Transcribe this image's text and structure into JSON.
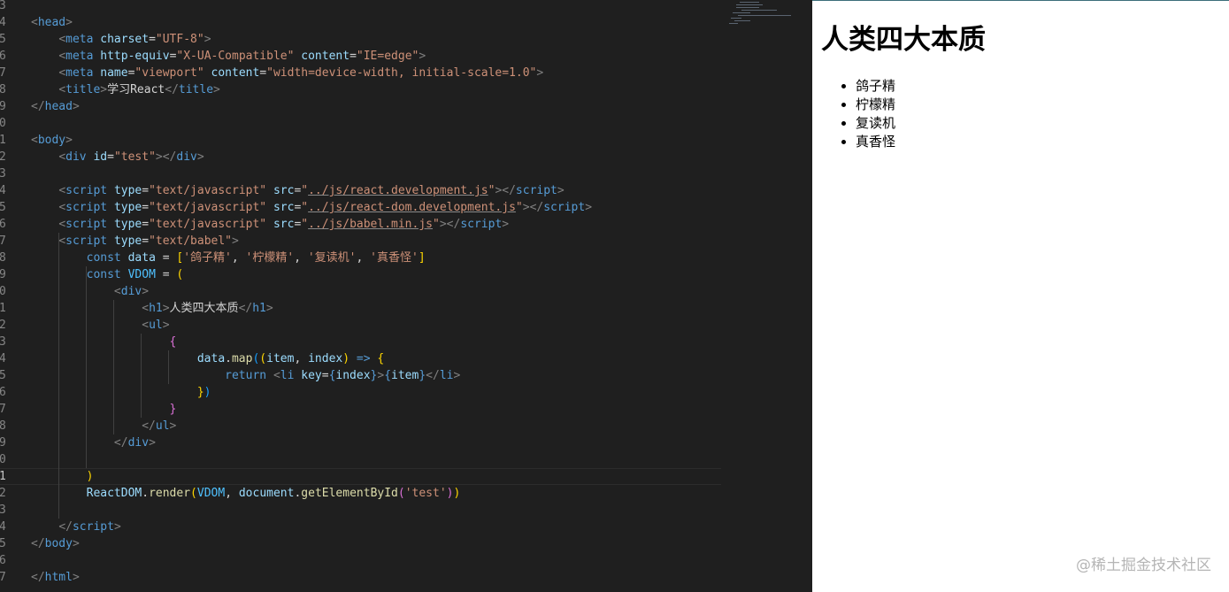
{
  "editor": {
    "lines": [
      {
        "num": "3",
        "tokens": []
      },
      {
        "num": "4",
        "tokens": [
          [
            "br",
            "<"
          ],
          [
            "tg",
            "head"
          ],
          [
            "br",
            ">"
          ]
        ]
      },
      {
        "num": "5",
        "tokens": [
          [
            "tx",
            "    "
          ],
          [
            "br",
            "<"
          ],
          [
            "tg",
            "meta "
          ],
          [
            "at",
            "charset"
          ],
          [
            "tx",
            "="
          ],
          [
            "st",
            "\"UTF-8\""
          ],
          [
            "br",
            ">"
          ]
        ]
      },
      {
        "num": "6",
        "tokens": [
          [
            "tx",
            "    "
          ],
          [
            "br",
            "<"
          ],
          [
            "tg",
            "meta "
          ],
          [
            "at",
            "http-equiv"
          ],
          [
            "tx",
            "="
          ],
          [
            "st",
            "\"X-UA-Compatible\" "
          ],
          [
            "at",
            "content"
          ],
          [
            "tx",
            "="
          ],
          [
            "st",
            "\"IE=edge\""
          ],
          [
            "br",
            ">"
          ]
        ]
      },
      {
        "num": "7",
        "tokens": [
          [
            "tx",
            "    "
          ],
          [
            "br",
            "<"
          ],
          [
            "tg",
            "meta "
          ],
          [
            "at",
            "name"
          ],
          [
            "tx",
            "="
          ],
          [
            "st",
            "\"viewport\" "
          ],
          [
            "at",
            "content"
          ],
          [
            "tx",
            "="
          ],
          [
            "st",
            "\"width=device-width, initial-scale=1.0\""
          ],
          [
            "br",
            ">"
          ]
        ]
      },
      {
        "num": "8",
        "tokens": [
          [
            "tx",
            "    "
          ],
          [
            "br",
            "<"
          ],
          [
            "tg",
            "title"
          ],
          [
            "br",
            ">"
          ],
          [
            "tx",
            "学习React"
          ],
          [
            "br",
            "</"
          ],
          [
            "tg",
            "title"
          ],
          [
            "br",
            ">"
          ]
        ]
      },
      {
        "num": "9",
        "tokens": [
          [
            "br",
            "</"
          ],
          [
            "tg",
            "head"
          ],
          [
            "br",
            ">"
          ]
        ]
      },
      {
        "num": "0",
        "tokens": []
      },
      {
        "num": "1",
        "tokens": [
          [
            "br",
            "<"
          ],
          [
            "tg",
            "body"
          ],
          [
            "br",
            ">"
          ]
        ]
      },
      {
        "num": "2",
        "tokens": [
          [
            "tx",
            "    "
          ],
          [
            "br",
            "<"
          ],
          [
            "tg",
            "div "
          ],
          [
            "at",
            "id"
          ],
          [
            "tx",
            "="
          ],
          [
            "st",
            "\"test\""
          ],
          [
            "br",
            "></"
          ],
          [
            "tg",
            "div"
          ],
          [
            "br",
            ">"
          ]
        ]
      },
      {
        "num": "3",
        "tokens": []
      },
      {
        "num": "4",
        "tokens": [
          [
            "tx",
            "    "
          ],
          [
            "br",
            "<"
          ],
          [
            "tg",
            "script "
          ],
          [
            "at",
            "type"
          ],
          [
            "tx",
            "="
          ],
          [
            "st",
            "\"text/javascript\" "
          ],
          [
            "at",
            "src"
          ],
          [
            "tx",
            "="
          ],
          [
            "st",
            "\""
          ],
          [
            "lk",
            "../js/react.development.js"
          ],
          [
            "st",
            "\""
          ],
          [
            "br",
            "></"
          ],
          [
            "tg",
            "script"
          ],
          [
            "br",
            ">"
          ]
        ]
      },
      {
        "num": "5",
        "tokens": [
          [
            "tx",
            "    "
          ],
          [
            "br",
            "<"
          ],
          [
            "tg",
            "script "
          ],
          [
            "at",
            "type"
          ],
          [
            "tx",
            "="
          ],
          [
            "st",
            "\"text/javascript\" "
          ],
          [
            "at",
            "src"
          ],
          [
            "tx",
            "="
          ],
          [
            "st",
            "\""
          ],
          [
            "lk",
            "../js/react-dom.development.js"
          ],
          [
            "st",
            "\""
          ],
          [
            "br",
            "></"
          ],
          [
            "tg",
            "script"
          ],
          [
            "br",
            ">"
          ]
        ]
      },
      {
        "num": "6",
        "tokens": [
          [
            "tx",
            "    "
          ],
          [
            "br",
            "<"
          ],
          [
            "tg",
            "script "
          ],
          [
            "at",
            "type"
          ],
          [
            "tx",
            "="
          ],
          [
            "st",
            "\"text/javascript\" "
          ],
          [
            "at",
            "src"
          ],
          [
            "tx",
            "="
          ],
          [
            "st",
            "\""
          ],
          [
            "lk",
            "../js/babel.min.js"
          ],
          [
            "st",
            "\""
          ],
          [
            "br",
            "></"
          ],
          [
            "tg",
            "script"
          ],
          [
            "br",
            ">"
          ]
        ]
      },
      {
        "num": "7",
        "tokens": [
          [
            "tx",
            "    "
          ],
          [
            "br",
            "<"
          ],
          [
            "tg",
            "script "
          ],
          [
            "at",
            "type"
          ],
          [
            "tx",
            "="
          ],
          [
            "st",
            "\"text/babel\""
          ],
          [
            "br",
            ">"
          ]
        ]
      },
      {
        "num": "8",
        "tokens": [
          [
            "tx",
            "        "
          ],
          [
            "kw",
            "const "
          ],
          [
            "vr",
            "data"
          ],
          [
            "tx",
            " = "
          ],
          [
            "b1",
            "["
          ],
          [
            "st",
            "'鸽子精'"
          ],
          [
            "tx",
            ", "
          ],
          [
            "st",
            "'柠檬精'"
          ],
          [
            "tx",
            ", "
          ],
          [
            "st",
            "'复读机'"
          ],
          [
            "tx",
            ", "
          ],
          [
            "st",
            "'真香怪'"
          ],
          [
            "b1",
            "]"
          ]
        ]
      },
      {
        "num": "9",
        "tokens": [
          [
            "tx",
            "        "
          ],
          [
            "kw",
            "const "
          ],
          [
            "cn",
            "VDOM"
          ],
          [
            "tx",
            " = "
          ],
          [
            "b1",
            "("
          ]
        ]
      },
      {
        "num": "0",
        "tokens": [
          [
            "tx",
            "            "
          ],
          [
            "br",
            "<"
          ],
          [
            "tg",
            "div"
          ],
          [
            "br",
            ">"
          ]
        ]
      },
      {
        "num": "1",
        "tokens": [
          [
            "tx",
            "                "
          ],
          [
            "br",
            "<"
          ],
          [
            "tg",
            "h1"
          ],
          [
            "br",
            ">"
          ],
          [
            "tx",
            "人类四大本质"
          ],
          [
            "br",
            "</"
          ],
          [
            "tg",
            "h1"
          ],
          [
            "br",
            ">"
          ]
        ]
      },
      {
        "num": "2",
        "tokens": [
          [
            "tx",
            "                "
          ],
          [
            "br",
            "<"
          ],
          [
            "tg",
            "ul"
          ],
          [
            "br",
            ">"
          ]
        ]
      },
      {
        "num": "3",
        "tokens": [
          [
            "tx",
            "                    "
          ],
          [
            "b2",
            "{"
          ]
        ]
      },
      {
        "num": "4",
        "tokens": [
          [
            "tx",
            "                        "
          ],
          [
            "vr",
            "data"
          ],
          [
            "tx",
            "."
          ],
          [
            "fn",
            "map"
          ],
          [
            "b3",
            "("
          ],
          [
            "b1",
            "("
          ],
          [
            "vr",
            "item"
          ],
          [
            "tx",
            ", "
          ],
          [
            "vr",
            "index"
          ],
          [
            "b1",
            ")"
          ],
          [
            "tx",
            " "
          ],
          [
            "kw",
            "=>"
          ],
          [
            "tx",
            " "
          ],
          [
            "b1",
            "{"
          ]
        ]
      },
      {
        "num": "5",
        "tokens": [
          [
            "tx",
            "                            "
          ],
          [
            "kw",
            "return "
          ],
          [
            "br",
            "<"
          ],
          [
            "tg",
            "li "
          ],
          [
            "at",
            "key"
          ],
          [
            "tx",
            "="
          ],
          [
            "kw",
            "{"
          ],
          [
            "vr",
            "index"
          ],
          [
            "kw",
            "}"
          ],
          [
            "br",
            ">"
          ],
          [
            "kw",
            "{"
          ],
          [
            "vr",
            "item"
          ],
          [
            "kw",
            "}"
          ],
          [
            "br",
            "</"
          ],
          [
            "tg",
            "li"
          ],
          [
            "br",
            ">"
          ]
        ]
      },
      {
        "num": "6",
        "tokens": [
          [
            "tx",
            "                        "
          ],
          [
            "b1",
            "}"
          ],
          [
            "b3",
            ")"
          ]
        ]
      },
      {
        "num": "7",
        "tokens": [
          [
            "tx",
            "                    "
          ],
          [
            "b2",
            "}"
          ]
        ]
      },
      {
        "num": "8",
        "tokens": [
          [
            "tx",
            "                "
          ],
          [
            "br",
            "</"
          ],
          [
            "tg",
            "ul"
          ],
          [
            "br",
            ">"
          ]
        ]
      },
      {
        "num": "9",
        "tokens": [
          [
            "tx",
            "            "
          ],
          [
            "br",
            "</"
          ],
          [
            "tg",
            "div"
          ],
          [
            "br",
            ">"
          ]
        ]
      },
      {
        "num": "0",
        "tokens": []
      },
      {
        "num": "1",
        "tokens": [
          [
            "tx",
            "        "
          ],
          [
            "b1",
            ")"
          ]
        ]
      },
      {
        "num": "2",
        "tokens": [
          [
            "tx",
            "        "
          ],
          [
            "vr",
            "ReactDOM"
          ],
          [
            "tx",
            "."
          ],
          [
            "fn",
            "render"
          ],
          [
            "b1",
            "("
          ],
          [
            "cn",
            "VDOM"
          ],
          [
            "tx",
            ", "
          ],
          [
            "vr",
            "document"
          ],
          [
            "tx",
            "."
          ],
          [
            "fn",
            "getElementById"
          ],
          [
            "b2",
            "("
          ],
          [
            "st",
            "'test'"
          ],
          [
            "b2",
            ")"
          ],
          [
            "b1",
            ")"
          ]
        ]
      },
      {
        "num": "3",
        "tokens": []
      },
      {
        "num": "4",
        "tokens": [
          [
            "tx",
            "    "
          ],
          [
            "br",
            "</"
          ],
          [
            "tg",
            "script"
          ],
          [
            "br",
            ">"
          ]
        ]
      },
      {
        "num": "5",
        "tokens": [
          [
            "br",
            "</"
          ],
          [
            "tg",
            "body"
          ],
          [
            "br",
            ">"
          ]
        ]
      },
      {
        "num": "6",
        "tokens": []
      },
      {
        "num": "7",
        "tokens": [
          [
            "br",
            "</"
          ],
          [
            "tg",
            "html"
          ],
          [
            "br",
            ">"
          ]
        ]
      }
    ],
    "current_line_index": 28
  },
  "preview": {
    "heading": "人类四大本质",
    "items": [
      "鸽子精",
      "柠檬精",
      "复读机",
      "真香怪"
    ]
  },
  "watermark": "@稀土掘金技术社区",
  "colors": {
    "editor_bg": "#1f1f1f",
    "tag": "#569cd6",
    "attribute": "#9cdcfe",
    "string": "#ce9178",
    "function": "#dcdcaa",
    "bracket_gold": "#ffd700",
    "bracket_purple": "#da70d6",
    "bracket_blue": "#179fff",
    "preview_bg": "#ffffff"
  }
}
